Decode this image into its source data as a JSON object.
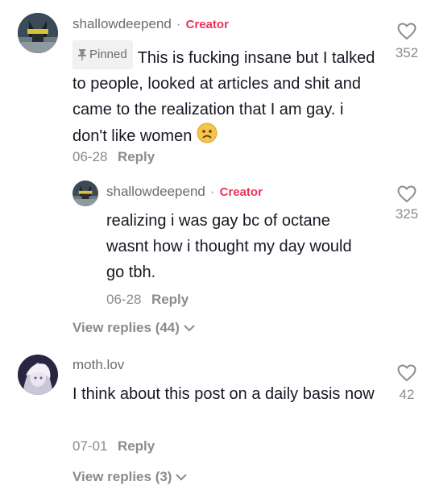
{
  "comments": [
    {
      "username": "shallowdeepend",
      "separator": "·",
      "badge": "Creator",
      "pinned_label": "Pinned",
      "text": "This is fucking insane but I talked to people, looked at articles and shit and came to the realization that I am gay. i don't like women",
      "emoji": "worried-face",
      "date": "06-28",
      "reply_label": "Reply",
      "likes": "352",
      "view_replies": "View replies (44)"
    },
    {
      "username": "shallowdeepend",
      "separator": "·",
      "badge": "Creator",
      "text": "realizing i was gay bc of octane wasnt how i thought my day would go tbh.",
      "date": "06-28",
      "reply_label": "Reply",
      "likes": "325"
    },
    {
      "username": "moth.lov",
      "text": "I think about this post on a daily basis now",
      "date": "07-01",
      "reply_label": "Reply",
      "likes": "42",
      "view_replies": "View replies (3)"
    }
  ],
  "icons": {
    "like": "heart-outline-icon",
    "expand": "chevron-down-icon",
    "pin": "pin-icon"
  },
  "colors": {
    "creator_badge": "#e8345a",
    "muted": "#8a8b91",
    "text": "#161823"
  }
}
